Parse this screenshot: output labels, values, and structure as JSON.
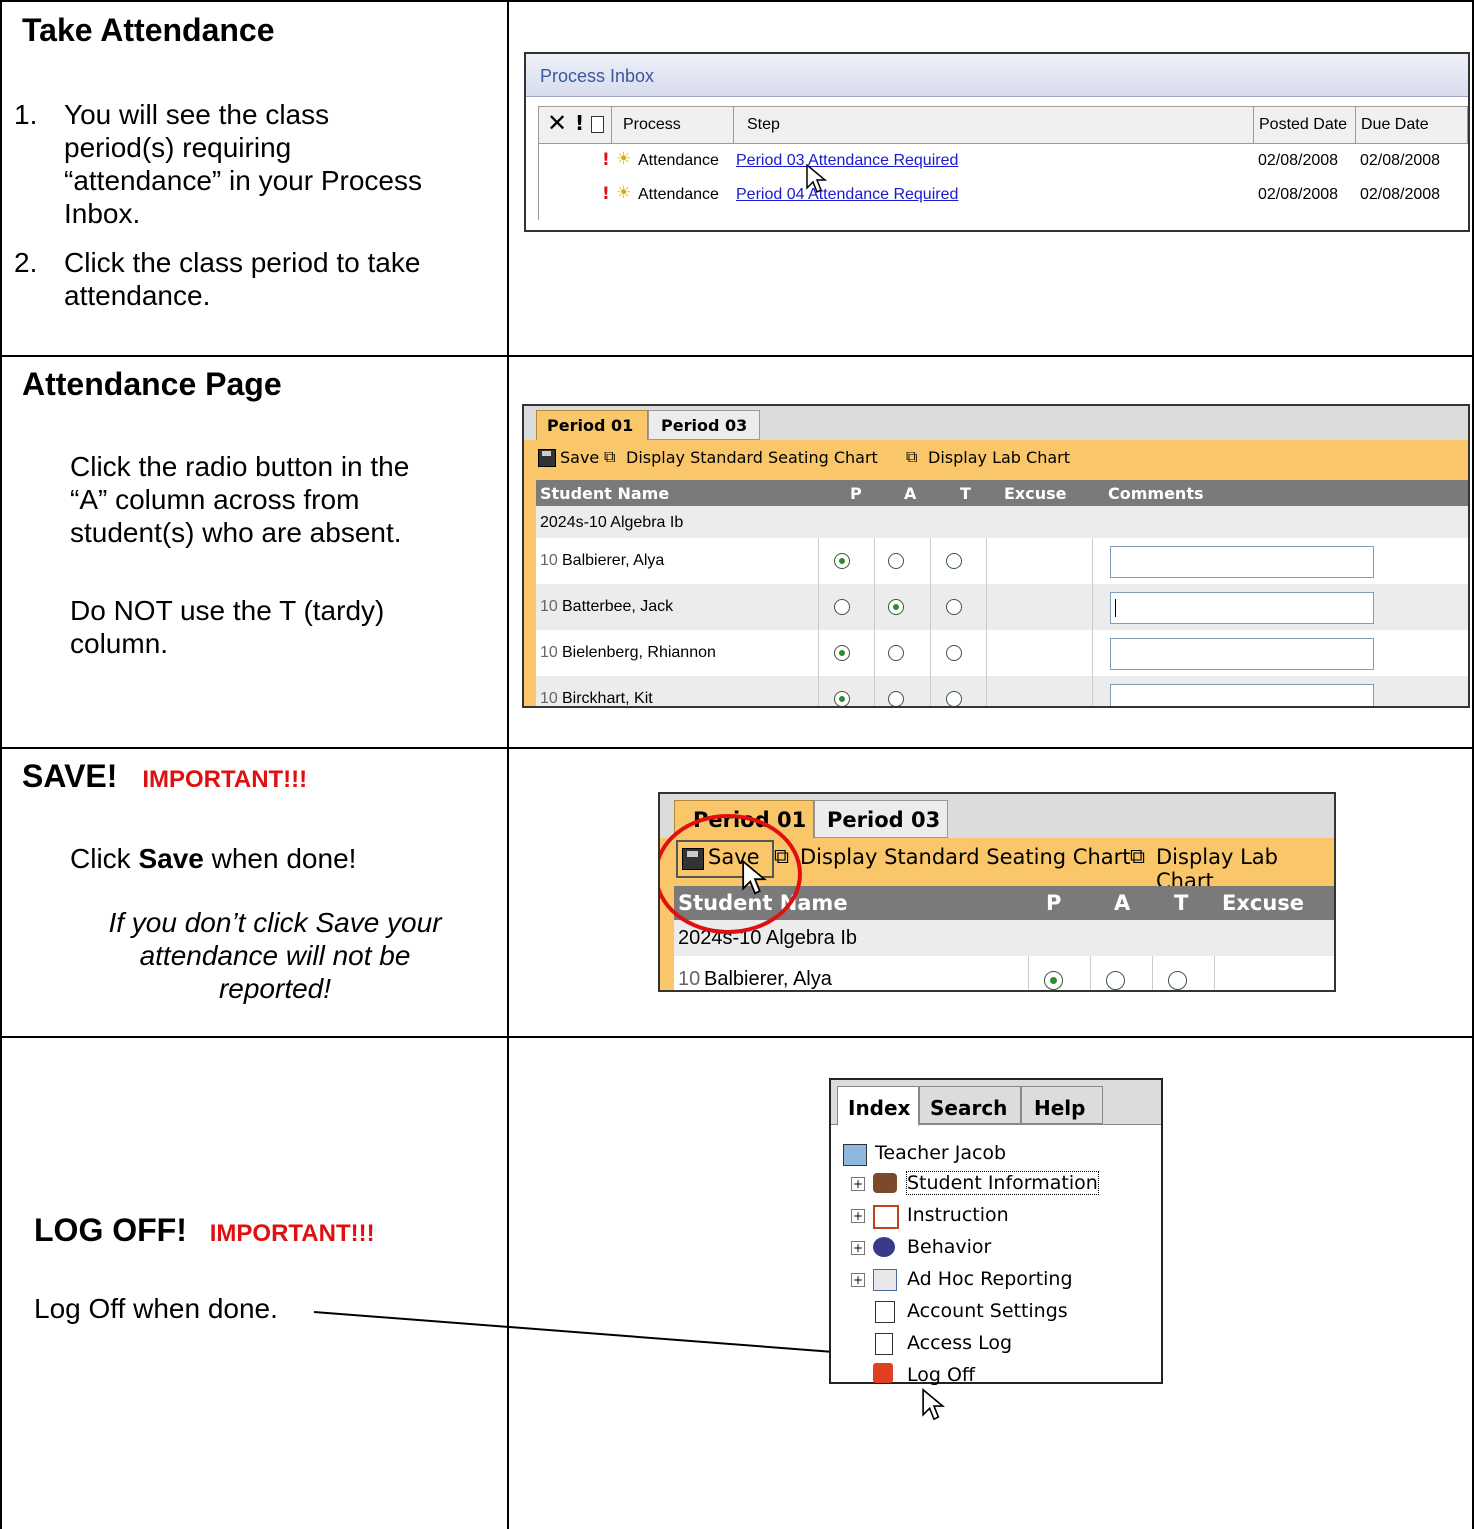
{
  "section1": {
    "heading": "Take Attendance",
    "step1_num": "1.",
    "step1_lines": [
      "You will see the class",
      "period(s) requiring",
      "“attendance” in your Process",
      "Inbox."
    ],
    "step2_num": "2.",
    "step2_lines": [
      "Click the class period to take",
      "attendance."
    ],
    "inbox": {
      "title": "Process Inbox",
      "columns": {
        "process": "Process",
        "step": "Step",
        "posted": "Posted Date",
        "due": "Due Date"
      },
      "rows": [
        {
          "process": "Attendance",
          "step": "Period 03 Attendance Required",
          "posted": "02/08/2008",
          "due": "02/08/2008"
        },
        {
          "process": "Attendance",
          "step": "Period 04 Attendance Required",
          "posted": "02/08/2008",
          "due": "02/08/2008"
        }
      ]
    }
  },
  "section2": {
    "heading": "Attendance Page",
    "para1_lines": [
      "Click the radio button in the",
      "“A” column across from",
      "student(s) who are absent."
    ],
    "para2_lines": [
      "Do NOT use the T (tardy)",
      "column."
    ],
    "ui": {
      "tabs": [
        "Period 01",
        "Period 03"
      ],
      "toolbar": {
        "save": "Save",
        "seating": "Display Standard Seating Chart",
        "lab": "Display Lab Chart"
      },
      "headers": {
        "name": "Student Name",
        "p": "P",
        "a": "A",
        "t": "T",
        "excuse": "Excuse",
        "comments": "Comments"
      },
      "group": "2024s-10 Algebra Ib",
      "students": [
        {
          "grade": "10",
          "name": "Balbierer, Alya",
          "selected": "P"
        },
        {
          "grade": "10",
          "name": "Batterbee, Jack",
          "selected": "A"
        },
        {
          "grade": "10",
          "name": "Bielenberg, Rhiannon",
          "selected": "P"
        },
        {
          "grade": "10",
          "name": "Birckhart, Kit",
          "selected": "P"
        }
      ]
    }
  },
  "section3": {
    "heading": "SAVE!",
    "important": "IMPORTANT!!!",
    "click": "Click ",
    "save_word": "Save",
    "when_done": " when done!",
    "warning_lines": [
      "If you don’t click Save your",
      "attendance will not be",
      "reported!"
    ],
    "ui": {
      "tabs": [
        "Period 01",
        "Period 03"
      ],
      "toolbar": {
        "save": "Save",
        "seating": "Display Standard Seating Chart",
        "lab": "Display Lab Chart"
      },
      "headers": {
        "name": "Student Name",
        "p": "P",
        "a": "A",
        "t": "T",
        "excuse": "Excuse"
      },
      "group": "2024s-10 Algebra Ib",
      "student": {
        "grade": "10",
        "name": "Balbierer, Alya"
      },
      "highlight_color": "#e01010"
    }
  },
  "section4": {
    "heading": "LOG OFF!",
    "important": "IMPORTANT!!!",
    "instruction": "Log Off when done.",
    "nav": {
      "tabs": [
        "Index",
        "Search",
        "Help"
      ],
      "root": "Teacher Jacob",
      "items": [
        "Student Information",
        "Instruction",
        "Behavior",
        "Ad Hoc Reporting",
        "Account Settings",
        "Access Log",
        "Log Off"
      ]
    }
  },
  "colors": {
    "accent_orange": "#f9c66a",
    "header_gray": "#7a7a7a",
    "important_red": "#e01010",
    "link_blue": "#1a1ad0"
  }
}
